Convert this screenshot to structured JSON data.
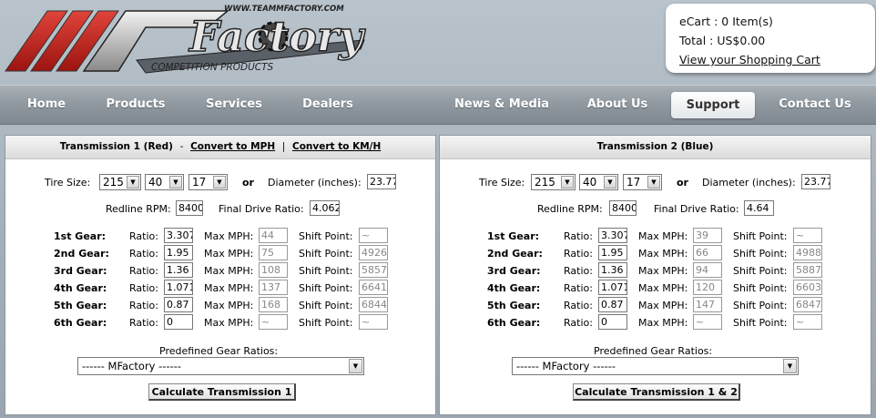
{
  "header": {
    "url_text": "WWW.TEAMMFACTORY.COM",
    "logo_main": "Factory",
    "logo_sub": "COMPETITION PRODUCTS"
  },
  "cart": {
    "items_line": "eCart : 0 Item(s)",
    "total_line": "Total : US$0.00",
    "view_link": "View your Shopping Cart"
  },
  "nav": {
    "items": [
      "Home",
      "Products",
      "Services",
      "Dealers",
      "News & Media",
      "About Us",
      "Support",
      "Contact Us"
    ],
    "active": "Support"
  },
  "labels": {
    "tire_size": "Tire Size:",
    "or": "or",
    "diameter": "Diameter (inches):",
    "redline": "Redline RPM:",
    "final_drive": "Final Drive Ratio:",
    "ratio": "Ratio:",
    "max_mph": "Max MPH:",
    "shift_point": "Shift Point:",
    "predefined": "Predefined Gear Ratios:",
    "convert_mph": "Convert to MPH",
    "convert_kmh": "Convert to KM/H",
    "dash": "-",
    "pipe": "|"
  },
  "gear_names": [
    "1st Gear:",
    "2nd Gear:",
    "3rd Gear:",
    "4th Gear:",
    "5th Gear:",
    "6th Gear:"
  ],
  "transmissions": [
    {
      "title": "Transmission 1 (Red)",
      "tire_width": "215",
      "tire_aspect": "40",
      "tire_rim": "17",
      "diameter": "23.77",
      "redline": "8400",
      "final_drive": "4.062",
      "gears": [
        {
          "ratio": "3.307",
          "max": "44",
          "shift": "~"
        },
        {
          "ratio": "1.95",
          "max": "75",
          "shift": "4926"
        },
        {
          "ratio": "1.36",
          "max": "108",
          "shift": "5857"
        },
        {
          "ratio": "1.071",
          "max": "137",
          "shift": "6641"
        },
        {
          "ratio": "0.87",
          "max": "168",
          "shift": "6844"
        },
        {
          "ratio": "0",
          "max": "~",
          "shift": "~"
        }
      ],
      "predefined": "------ MFactory ------",
      "button": "Calculate Transmission 1"
    },
    {
      "title": "Transmission 2 (Blue)",
      "tire_width": "215",
      "tire_aspect": "40",
      "tire_rim": "17",
      "diameter": "23.77",
      "redline": "8400",
      "final_drive": "4.64",
      "gears": [
        {
          "ratio": "3.307",
          "max": "39",
          "shift": "~"
        },
        {
          "ratio": "1.95",
          "max": "66",
          "shift": "4988"
        },
        {
          "ratio": "1.36",
          "max": "94",
          "shift": "5887"
        },
        {
          "ratio": "1.071",
          "max": "120",
          "shift": "6603"
        },
        {
          "ratio": "0.87",
          "max": "147",
          "shift": "6847"
        },
        {
          "ratio": "0",
          "max": "~",
          "shift": "~"
        }
      ],
      "predefined": "------ MFactory ------",
      "button": "Calculate Transmission 1 & 2"
    }
  ]
}
